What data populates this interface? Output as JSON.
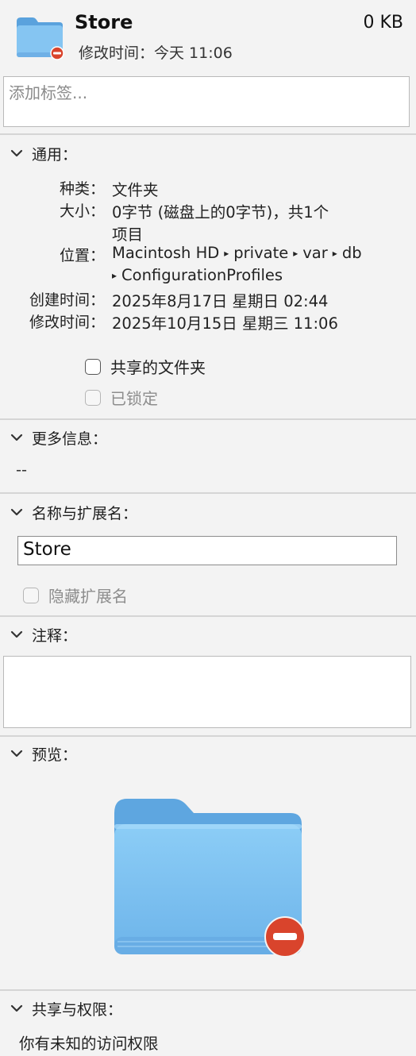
{
  "header": {
    "name": "Store",
    "size": "0 KB",
    "modified": "修改时间：今天 11:06"
  },
  "tags": {
    "placeholder": "添加标签..."
  },
  "general": {
    "title": "通用：",
    "kind_label": "种类：",
    "kind_value": "文件夹",
    "size_label": "大小：",
    "size_value_line1": "0字节 (磁盘上的0字节)，共1个",
    "size_value_line2": "项目",
    "where_label": "位置：",
    "path": [
      "Macintosh HD",
      "private",
      "var",
      "db",
      "ConfigurationProfiles"
    ],
    "created_label": "创建时间：",
    "created_value": "2025年8月17日 星期日 02:44",
    "modified_label": "修改时间：",
    "modified_value": "2025年10月15日 星期三 11:06",
    "shared_folder": "共享的文件夹",
    "locked": "已锁定"
  },
  "more_info": {
    "title": "更多信息：",
    "value": "--"
  },
  "name_ext": {
    "title": "名称与扩展名：",
    "value": "Store",
    "hide_ext": "隐藏扩展名"
  },
  "comments": {
    "title": "注释："
  },
  "preview": {
    "title": "预览："
  },
  "sharing": {
    "title": "共享与权限：",
    "value": "你有未知的访问权限"
  },
  "colors": {
    "folder": "#7ec0f0",
    "folder_dark": "#5aa2dd",
    "badge": "#d9442c"
  }
}
